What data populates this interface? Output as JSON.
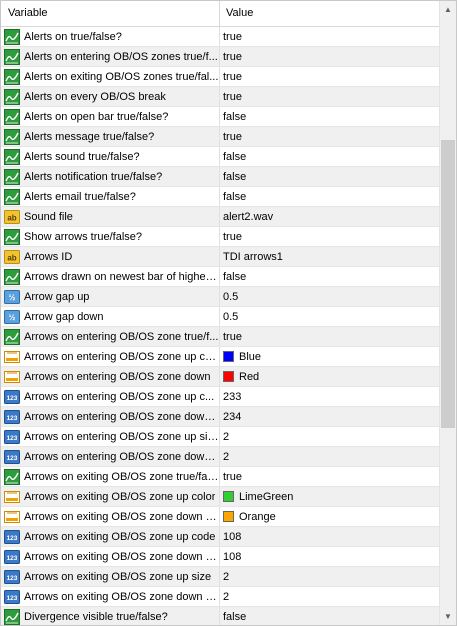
{
  "header": {
    "variable": "Variable",
    "value": "Value"
  },
  "rows": [
    {
      "icon": "bool",
      "name": "Alerts on true/false?",
      "value": "true"
    },
    {
      "icon": "bool",
      "name": "Alerts on entering OB/OS zones true/f...",
      "value": "true"
    },
    {
      "icon": "bool",
      "name": "Alerts on exiting OB/OS zones true/fal...",
      "value": "true"
    },
    {
      "icon": "bool",
      "name": "Alerts on every OB/OS break",
      "value": "true"
    },
    {
      "icon": "bool",
      "name": "Alerts on open bar true/false?",
      "value": "false"
    },
    {
      "icon": "bool",
      "name": "Alerts message true/false?",
      "value": "true"
    },
    {
      "icon": "bool",
      "name": "Alerts sound true/false?",
      "value": "false"
    },
    {
      "icon": "bool",
      "name": "Alerts notification true/false?",
      "value": "false"
    },
    {
      "icon": "bool",
      "name": "Alerts email true/false?",
      "value": "false"
    },
    {
      "icon": "string",
      "name": "Sound file",
      "value": "alert2.wav"
    },
    {
      "icon": "bool",
      "name": "Show arrows true/false?",
      "value": "true"
    },
    {
      "icon": "string",
      "name": "Arrows ID",
      "value": "TDI arrows1"
    },
    {
      "icon": "bool",
      "name": "Arrows drawn on newest bar of higher t...",
      "value": "false"
    },
    {
      "icon": "double",
      "name": "Arrow gap up",
      "value": "0.5"
    },
    {
      "icon": "double",
      "name": "Arrow gap down",
      "value": "0.5"
    },
    {
      "icon": "bool",
      "name": "Arrows on entering OB/OS zone true/f...",
      "value": "true"
    },
    {
      "icon": "color",
      "name": "Arrows on entering OB/OS zone up color",
      "value": "Blue",
      "swatch": "#0000ff"
    },
    {
      "icon": "color",
      "name": "Arrows on entering OB/OS zone down",
      "value": "Red",
      "swatch": "#ff0000"
    },
    {
      "icon": "int",
      "name": "Arrows on entering OB/OS zone up c...",
      "value": "233"
    },
    {
      "icon": "int",
      "name": "Arrows on entering OB/OS zone down ...",
      "value": "234"
    },
    {
      "icon": "int",
      "name": "Arrows on entering OB/OS zone up size",
      "value": "2"
    },
    {
      "icon": "int",
      "name": "Arrows on entering OB/OS zone down ...",
      "value": "2"
    },
    {
      "icon": "bool",
      "name": "Arrows on exiting OB/OS zone true/fal...",
      "value": "true"
    },
    {
      "icon": "color",
      "name": "Arrows on exiting OB/OS zone up color",
      "value": "LimeGreen",
      "swatch": "#32cd32"
    },
    {
      "icon": "color",
      "name": "Arrows on exiting OB/OS zone down c...",
      "value": "Orange",
      "swatch": "#ffa500"
    },
    {
      "icon": "int",
      "name": "Arrows on exiting OB/OS zone up code",
      "value": "108"
    },
    {
      "icon": "int",
      "name": "Arrows on exiting OB/OS zone down c...",
      "value": "108"
    },
    {
      "icon": "int",
      "name": "Arrows on exiting OB/OS zone up size",
      "value": "2"
    },
    {
      "icon": "int",
      "name": "Arrows on exiting OB/OS zone down s...",
      "value": "2"
    },
    {
      "icon": "bool",
      "name": "Divergence visible true/false?",
      "value": "false"
    }
  ],
  "icon_names": {
    "bool": "boolean-icon",
    "string": "string-ab-icon",
    "double": "double-half-icon",
    "int": "integer-123-icon",
    "color": "color-icon"
  },
  "colors": {
    "accent_green": "#2e9c3c",
    "alt_row": "#f0f0f0"
  }
}
